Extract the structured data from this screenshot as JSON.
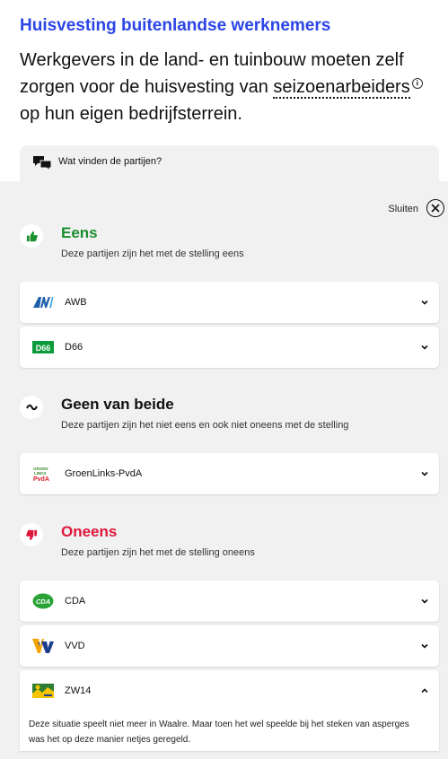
{
  "topic": {
    "title": "Huisvesting buitenlandse werknemers",
    "statement_part1": "Werkgevers in de land- en tuinbouw moeten zelf zorgen voor de huisvesting van ",
    "statement_term": "seizoenarbeiders",
    "statement_part2": " op hun eigen bedrijfsterrein."
  },
  "question": {
    "label": "Wat vinden de partijen?"
  },
  "panel": {
    "close_label": "Sluiten",
    "groups": [
      {
        "title": "Eens",
        "color": "#1a8f2e",
        "icon": "thumbs-up-icon",
        "description": "Deze partijen zijn het met de stelling eens",
        "parties": [
          {
            "name": "AWB",
            "logo": "awb-logo"
          },
          {
            "name": "D66",
            "logo": "d66-logo"
          }
        ]
      },
      {
        "title": "Geen van beide",
        "color": "#111111",
        "icon": "tilde-icon",
        "description": "Deze partijen zijn het niet eens en ook niet oneens met de stelling",
        "parties": [
          {
            "name": "GroenLinks-PvdA",
            "logo": "groenlinks-pvda-logo"
          }
        ]
      },
      {
        "title": "Oneens",
        "color": "#e0173c",
        "icon": "thumbs-down-icon",
        "description": "Deze partijen zijn het met de stelling oneens",
        "parties": [
          {
            "name": "CDA",
            "logo": "cda-logo"
          },
          {
            "name": "VVD",
            "logo": "vvd-logo"
          },
          {
            "name": "ZW14",
            "logo": "zw14-logo",
            "expanded": true,
            "explanation": "Deze situatie speelt niet meer in Waalre. Maar toen het wel speelde bij het steken van asperges was het op deze manier netjes geregeld."
          }
        ]
      }
    ]
  },
  "colors": {
    "accent": "#2b45e6",
    "panel_bg": "#f1f1f1"
  }
}
